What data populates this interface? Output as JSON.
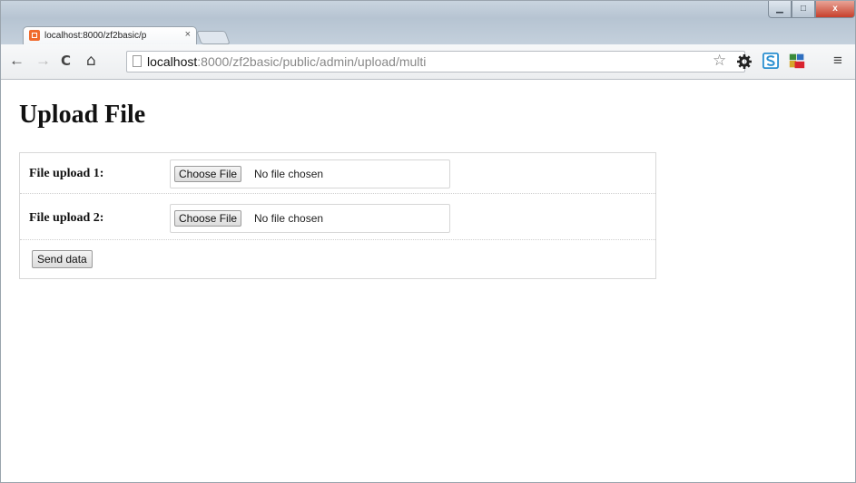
{
  "browser": {
    "tab_title": "localhost:8000/zf2basic/p",
    "tab_close": "×",
    "window_min": "▁",
    "window_max": "□",
    "window_close": "x",
    "back_glyph": "←",
    "forward_glyph": "→",
    "reload_glyph": "C",
    "home_glyph": "⌂",
    "url_host": "localhost",
    "url_path": ":8000/zf2basic/public/admin/upload/multi",
    "star_glyph": "☆",
    "menu_glyph": "≡",
    "accent_color": "#f06a2c"
  },
  "page": {
    "title": "Upload File"
  },
  "form": {
    "fields": [
      {
        "label": "File upload 1:",
        "button": "Choose File",
        "status": "No file chosen"
      },
      {
        "label": "File upload 2:",
        "button": "Choose File",
        "status": "No file chosen"
      }
    ],
    "submit": "Send data"
  }
}
